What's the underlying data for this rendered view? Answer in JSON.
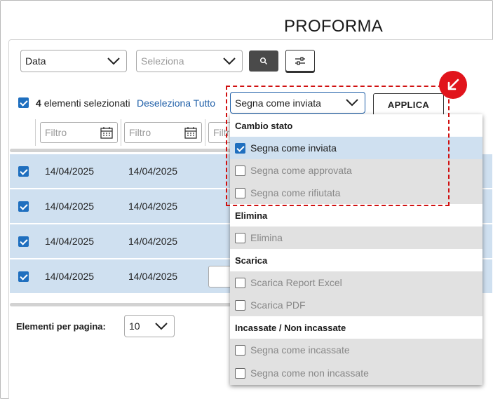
{
  "page": {
    "title": "PROFORMA"
  },
  "toolbar": {
    "date_select": "Data",
    "search_select_placeholder": "Seleziona",
    "search_icon": "search-icon",
    "filter_icon": "sliders-icon"
  },
  "selection": {
    "count": "4",
    "count_label": "elementi selezionati",
    "deselect_all": "Deseleziona Tutto",
    "action_select": "Segna come inviata",
    "apply_label": "APPLICA"
  },
  "filters": {
    "placeholder_1": "Filtro",
    "placeholder_2": "Filtro",
    "placeholder_3": "Filtr"
  },
  "rows": [
    {
      "date1": "14/04/2025",
      "date2": "14/04/2025"
    },
    {
      "date1": "14/04/2025",
      "date2": "14/04/2025"
    },
    {
      "date1": "14/04/2025",
      "date2": "14/04/2025"
    },
    {
      "date1": "14/04/2025",
      "date2": "14/04/2025"
    }
  ],
  "pagination": {
    "label": "Elementi per pagina:",
    "value": "10"
  },
  "dropdown": {
    "group_state": "Cambio stato",
    "item_sent": "Segna come inviata",
    "item_approved": "Segna come approvata",
    "item_rejected": "Segna come rifiutata",
    "group_delete": "Elimina",
    "item_delete": "Elimina",
    "group_download": "Scarica",
    "item_excel": "Scarica Report Excel",
    "item_pdf": "Scarica PDF",
    "group_cashed": "Incassate / Non incassate",
    "item_cashed": "Segna come incassate",
    "item_not_cashed": "Segna come non incassate"
  },
  "colors": {
    "accent_blue": "#1f6fbf",
    "row_selected": "#cfe0f0",
    "highlight_red": "#d01010"
  }
}
